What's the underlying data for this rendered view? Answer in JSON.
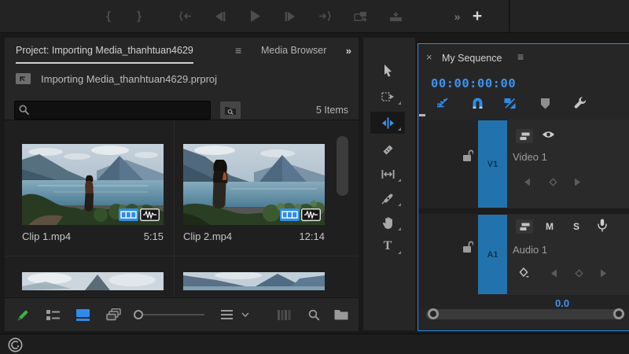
{
  "top_toolbar": {
    "mark_in": "{",
    "mark_out": "}",
    "expand": "»",
    "add": "+"
  },
  "project": {
    "tab_project": "Project: Importing Media_thanhtuan4629",
    "menu": "≡",
    "tab_media": "Media Browser",
    "overflow": "»",
    "file_name": "Importing Media_thanhtuan4629.prproj",
    "items_count": "5 Items",
    "clips": [
      {
        "name": "Clip 1.mp4",
        "duration": "5:15"
      },
      {
        "name": "Clip 2.mp4",
        "duration": "12:14"
      }
    ]
  },
  "tools": {
    "type_label": "T"
  },
  "timeline": {
    "close": "×",
    "tab": "My Sequence",
    "menu": "≡",
    "timecode": "00:00:00:00",
    "video": {
      "patch": "V1",
      "name": "Video 1"
    },
    "audio": {
      "patch": "A1",
      "name": "Audio 1",
      "mute": "M",
      "solo": "S"
    },
    "audio_level": "0.0"
  },
  "colors": {
    "accent_blue": "#2d8ceb",
    "timecode_blue": "#3f93ee",
    "patch_blue": "#2273ad",
    "pencil_green": "#3faf46",
    "panel_bg": "#262626",
    "window_bg": "#191919"
  }
}
